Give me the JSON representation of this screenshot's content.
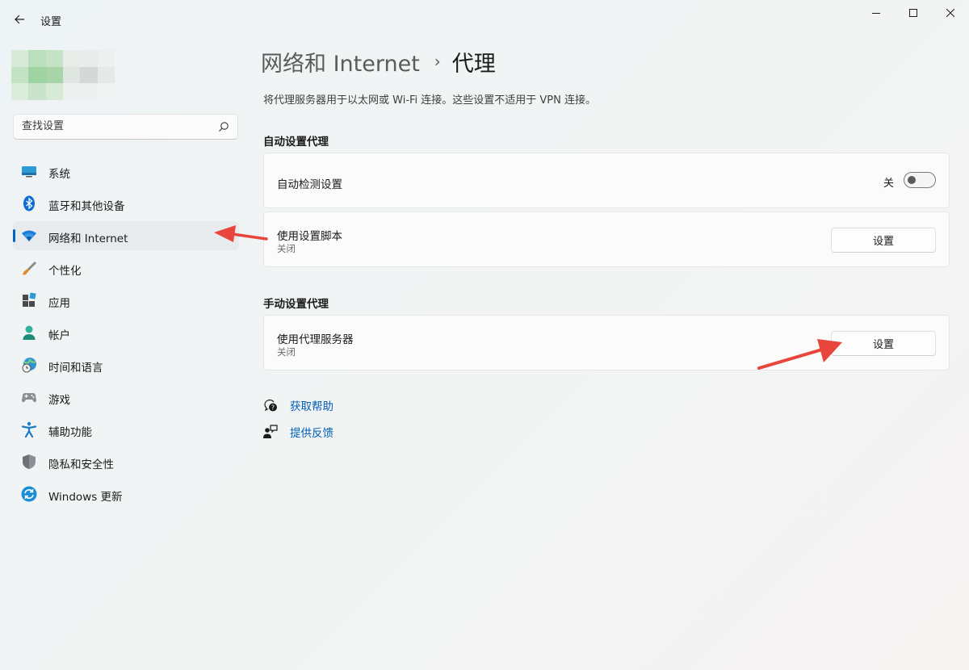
{
  "window": {
    "title": "设置",
    "controls": {
      "minimize_icon": "minimize-icon",
      "maximize_icon": "maximize-icon",
      "close_icon": "close-icon"
    }
  },
  "sidebar": {
    "search_placeholder": "查找设置",
    "items": [
      {
        "label": "系统",
        "icon": "monitor-icon",
        "active": false
      },
      {
        "label": "蓝牙和其他设备",
        "icon": "bluetooth-icon",
        "active": false
      },
      {
        "label": "网络和 Internet",
        "icon": "wifi-icon",
        "active": true
      },
      {
        "label": "个性化",
        "icon": "brush-icon",
        "active": false
      },
      {
        "label": "应用",
        "icon": "apps-icon",
        "active": false
      },
      {
        "label": "帐户",
        "icon": "person-icon",
        "active": false
      },
      {
        "label": "时间和语言",
        "icon": "globe-clock-icon",
        "active": false
      },
      {
        "label": "游戏",
        "icon": "gamepad-icon",
        "active": false
      },
      {
        "label": "辅助功能",
        "icon": "accessibility-icon",
        "active": false
      },
      {
        "label": "隐私和安全性",
        "icon": "shield-icon",
        "active": false
      },
      {
        "label": "Windows 更新",
        "icon": "update-icon",
        "active": false
      }
    ]
  },
  "main": {
    "breadcrumb": {
      "parent": "网络和 Internet",
      "separator": "›",
      "current": "代理"
    },
    "description": "将代理服务器用于以太网或 Wi-Fi 连接。这些设置不适用于 VPN 连接。",
    "auto_section": {
      "title": "自动设置代理",
      "detect": {
        "label": "自动检测设置",
        "toggle_label": "关",
        "toggle_on": false
      },
      "script": {
        "label": "使用设置脚本",
        "status": "关闭",
        "button": "设置"
      }
    },
    "manual_section": {
      "title": "手动设置代理",
      "proxy": {
        "label": "使用代理服务器",
        "status": "关闭",
        "button": "设置"
      }
    },
    "links": {
      "help": "获取帮助",
      "feedback": "提供反馈"
    }
  },
  "colors": {
    "accent": "#0067c0",
    "link": "#005fb8",
    "annotation": "#e8453c"
  }
}
